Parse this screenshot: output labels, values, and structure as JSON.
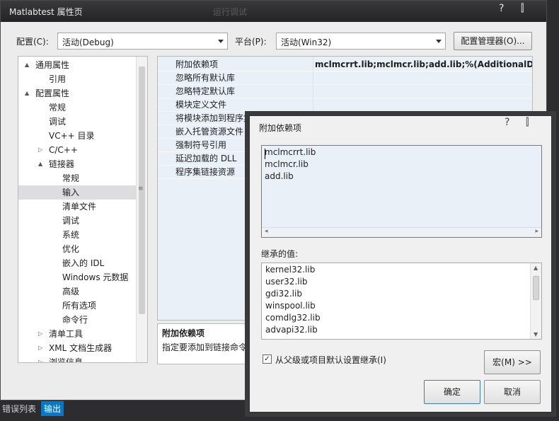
{
  "main_window": {
    "title": "Matlabtest 属性页",
    "ghost_title": "运行调试",
    "help_icon": "?",
    "pin_icon": "⫿",
    "config_label": "配置(C):",
    "config_value": "活动(Debug)",
    "platform_label": "平台(P):",
    "platform_value": "活动(Win32)",
    "config_manager_btn": "配置管理器(O)..."
  },
  "tree": {
    "items": [
      {
        "label": "通用属性",
        "twisty": "▲"
      },
      {
        "label": "引用",
        "twisty": ""
      },
      {
        "label": "配置属性",
        "twisty": "▲"
      },
      {
        "label": "常规",
        "twisty": ""
      },
      {
        "label": "调试",
        "twisty": ""
      },
      {
        "label": "VC++ 目录",
        "twisty": ""
      },
      {
        "label": "C/C++",
        "twisty": "▷"
      },
      {
        "label": "链接器",
        "twisty": "▲"
      },
      {
        "label": "常规",
        "twisty": ""
      },
      {
        "label": "输入",
        "twisty": ""
      },
      {
        "label": "清单文件",
        "twisty": ""
      },
      {
        "label": "调试",
        "twisty": ""
      },
      {
        "label": "系统",
        "twisty": ""
      },
      {
        "label": "优化",
        "twisty": ""
      },
      {
        "label": "嵌入的 IDL",
        "twisty": ""
      },
      {
        "label": "Windows 元数据",
        "twisty": ""
      },
      {
        "label": "高级",
        "twisty": ""
      },
      {
        "label": "所有选项",
        "twisty": ""
      },
      {
        "label": "命令行",
        "twisty": ""
      },
      {
        "label": "清单工具",
        "twisty": "▷"
      },
      {
        "label": "XML 文档生成器",
        "twisty": "▷"
      },
      {
        "label": "浏览信息",
        "twisty": "▷"
      }
    ],
    "selected": "输入"
  },
  "grid": {
    "rows": [
      {
        "name": "附加依赖项",
        "value": "mclmcrrt.lib;mclmcr.lib;add.lib;%(AdditionalDepen"
      },
      {
        "name": "忽略所有默认库",
        "value": ""
      },
      {
        "name": "忽略特定默认库",
        "value": ""
      },
      {
        "name": "模块定义文件",
        "value": ""
      },
      {
        "name": "将模块添加到程序集",
        "value": ""
      },
      {
        "name": "嵌入托管资源文件",
        "value": ""
      },
      {
        "name": "强制符号引用",
        "value": ""
      },
      {
        "name": "延迟加载的 DLL",
        "value": ""
      },
      {
        "name": "程序集链接资源",
        "value": ""
      }
    ]
  },
  "description": {
    "title": "附加依赖项",
    "text": "指定要添加到链接命令行"
  },
  "bottom_bar": {
    "error_list": "错误列表",
    "output": "输出"
  },
  "dialog": {
    "title": "附加依赖项",
    "help_icon": "?",
    "pin_icon": "⫿",
    "lines": [
      "mclmcrrt.lib",
      "mclmcr.lib",
      "add.lib"
    ],
    "inherited_label": "继承的值:",
    "inherited": [
      "kernel32.lib",
      "user32.lib",
      "gdi32.lib",
      "winspool.lib",
      "comdlg32.lib",
      "advapi32.lib"
    ],
    "inherit_check_label": "从父级或项目默认设置继承(I)",
    "inherit_checked": "✓",
    "macro_btn": "宏(M) >>",
    "ok_btn": "确定",
    "cancel_btn": "取消"
  }
}
